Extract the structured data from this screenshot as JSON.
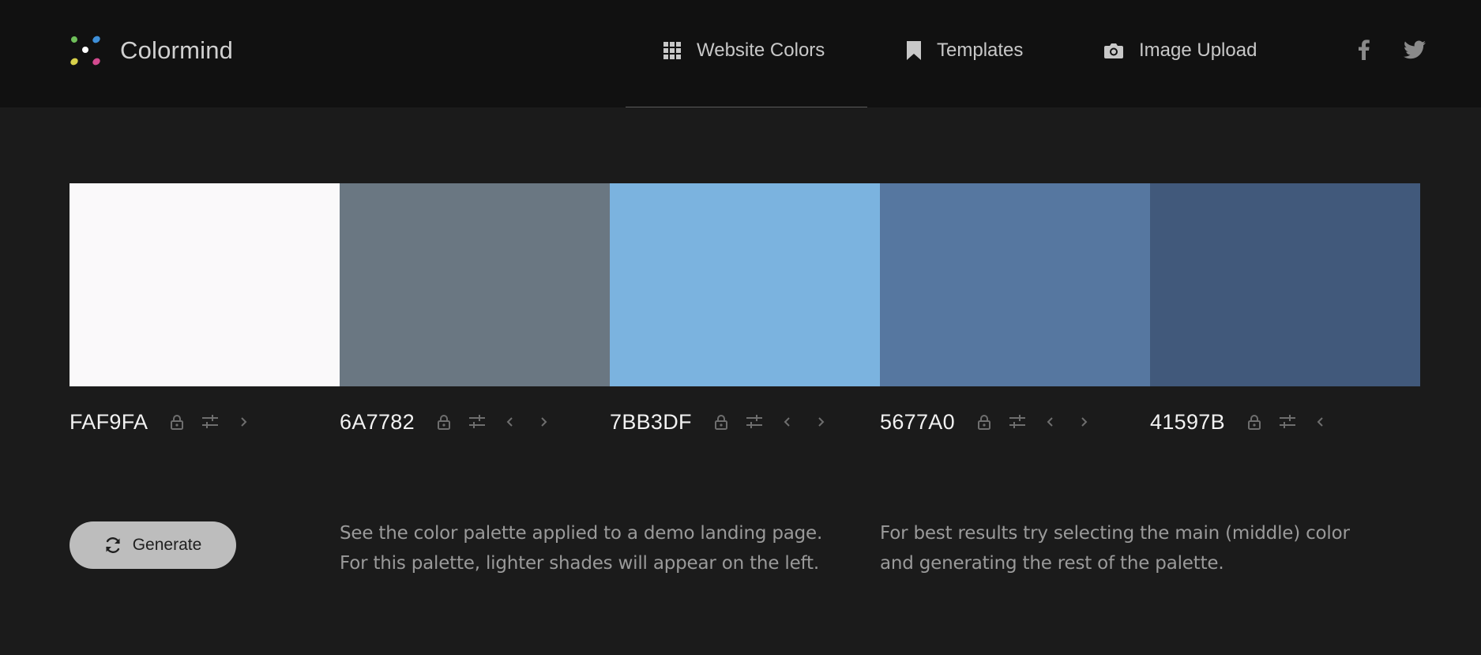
{
  "header": {
    "brand": "Colormind",
    "nav": [
      {
        "label": "Website Colors",
        "icon": "grid-icon"
      },
      {
        "label": "Templates",
        "icon": "bookmark-icon"
      },
      {
        "label": "Image Upload",
        "icon": "camera-icon"
      }
    ],
    "social": [
      "facebook-icon",
      "twitter-icon"
    ],
    "logo_dot_colors": [
      "#6fbf5a",
      "#3e8fd8",
      "#ffffff",
      "#d8d14a",
      "#d34a8f"
    ]
  },
  "palette": [
    {
      "hex": "FAF9FA",
      "color": "#FAF9FA"
    },
    {
      "hex": "6A7782",
      "color": "#6A7782"
    },
    {
      "hex": "7BB3DF",
      "color": "#7BB3DF"
    },
    {
      "hex": "5677A0",
      "color": "#5677A0"
    },
    {
      "hex": "41597B",
      "color": "#41597B"
    }
  ],
  "actions": {
    "generate_label": "Generate"
  },
  "info": {
    "demo_line1": "See the color palette applied to a demo landing page.",
    "demo_line2": "For this palette, lighter shades will appear on the left.",
    "tip_line1": "For best results try selecting the main (middle) color",
    "tip_line2": "and generating the rest of the palette."
  },
  "colors": {
    "page_background": "#1b1b1b",
    "header_background": "#111111",
    "button_background": "#bdbdbd",
    "control_icon": "#6e6e6e"
  }
}
